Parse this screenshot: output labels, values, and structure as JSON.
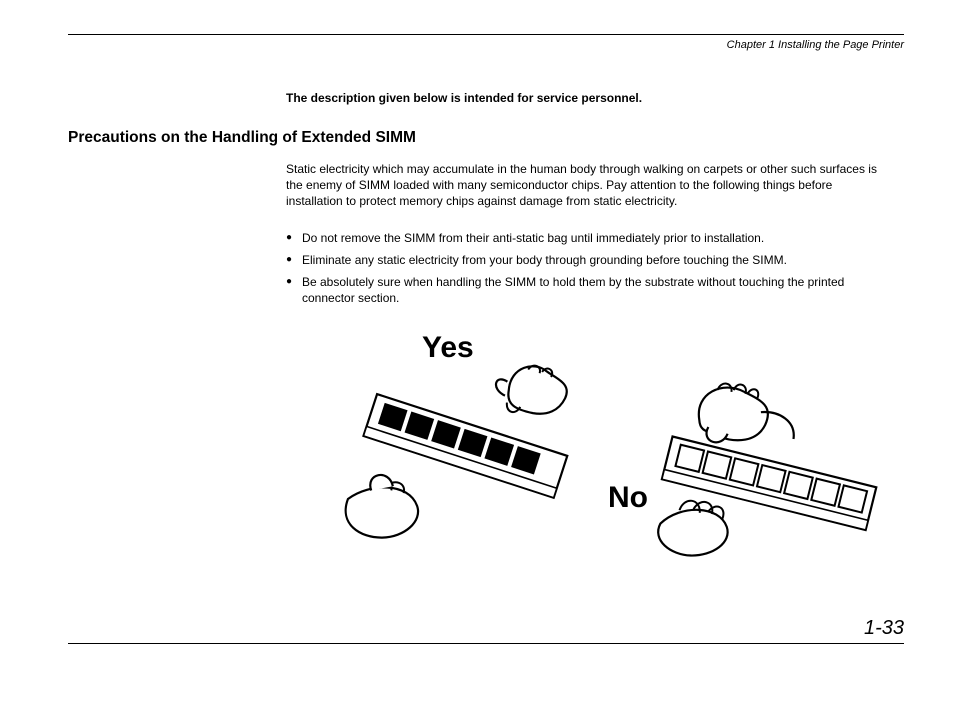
{
  "header": {
    "chapter": "Chapter 1  Installing the Page Printer"
  },
  "notice": "The description given below is intended for service personnel.",
  "section_title": "Precautions on the Handling of Extended SIMM",
  "intro": "Static electricity which may accumulate in the human body through walking on carpets or other such surfaces is the enemy of SIMM loaded with many semiconductor chips.  Pay attention to the following things before installation to protect memory chips against damage from static electricity.",
  "bullets": [
    "Do not remove the SIMM from their anti-static bag until immediately prior to installation.",
    "Eliminate any static electricity from your body through grounding before touching the SIMM.",
    "Be absolutely sure when handling the SIMM to hold them by the substrate without touching the printed connector section."
  ],
  "figure": {
    "yes": "Yes",
    "no": "No"
  },
  "page_number": "1-33"
}
